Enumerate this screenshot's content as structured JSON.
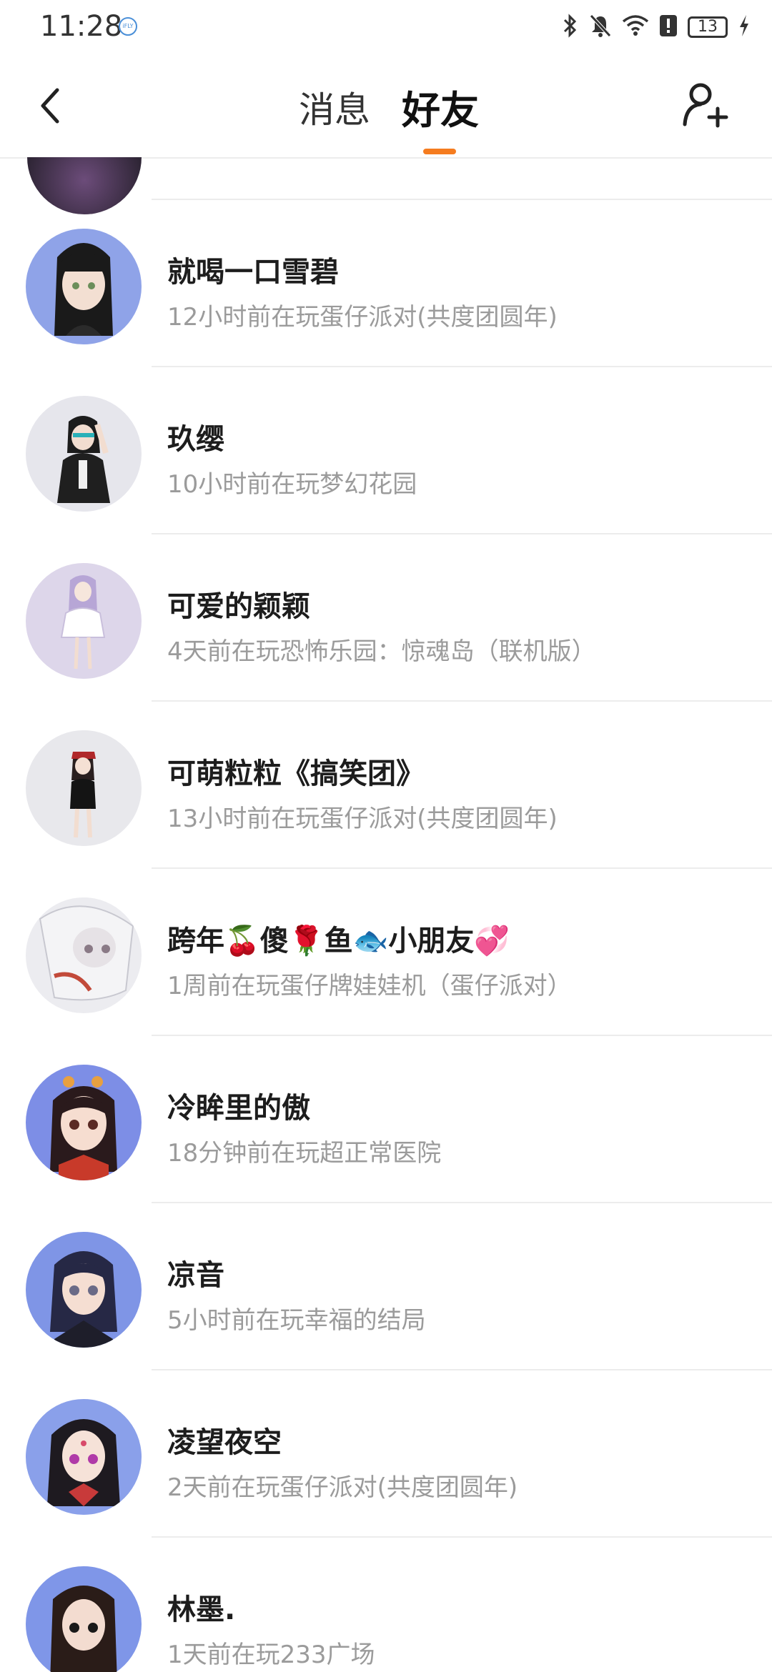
{
  "status_bar": {
    "time": "11:28",
    "ifly_badge": "iFLY",
    "battery": "13",
    "icons": [
      "bluetooth-icon",
      "mute-icon",
      "wifi-icon",
      "alert-icon",
      "battery-icon",
      "charging-icon"
    ]
  },
  "header": {
    "tabs": [
      {
        "label": "消息",
        "active": false
      },
      {
        "label": "好友",
        "active": true
      }
    ],
    "accent": "#f57c1f"
  },
  "friends": [
    {
      "name": "就喝一口雪碧",
      "status": "12小时前在玩蛋仔派对(共度团圆年)",
      "avatar_color": "#8fa3e8"
    },
    {
      "name": "玖缨",
      "status": "10小时前在玩梦幻花园",
      "avatar_color": "#e6e6ec"
    },
    {
      "name": "可爱的颖颖",
      "status": "4天前在玩恐怖乐园：惊魂岛（联机版）",
      "avatar_color": "#ddd6ea"
    },
    {
      "name": "可萌粒粒《搞笑团》",
      "status": "13小时前在玩蛋仔派对(共度团圆年)",
      "avatar_color": "#e8e8ec"
    },
    {
      "name": "跨年🍒傻🌹鱼🐟小朋友💞",
      "status": "1周前在玩蛋仔牌娃娃机（蛋仔派对）",
      "avatar_color": "#ececf0"
    },
    {
      "name": "冷眸里的傲",
      "status": "18分钟前在玩超正常医院",
      "avatar_color": "#7d8ee6"
    },
    {
      "name": "凉音",
      "status": "5小时前在玩幸福的结局",
      "avatar_color": "#7f95e6"
    },
    {
      "name": "凌望夜空",
      "status": "2天前在玩蛋仔派对(共度团圆年)",
      "avatar_color": "#8aa0ea"
    },
    {
      "name": "林墨.",
      "status": "1天前在玩233广场",
      "avatar_color": "#7f96e8"
    }
  ]
}
